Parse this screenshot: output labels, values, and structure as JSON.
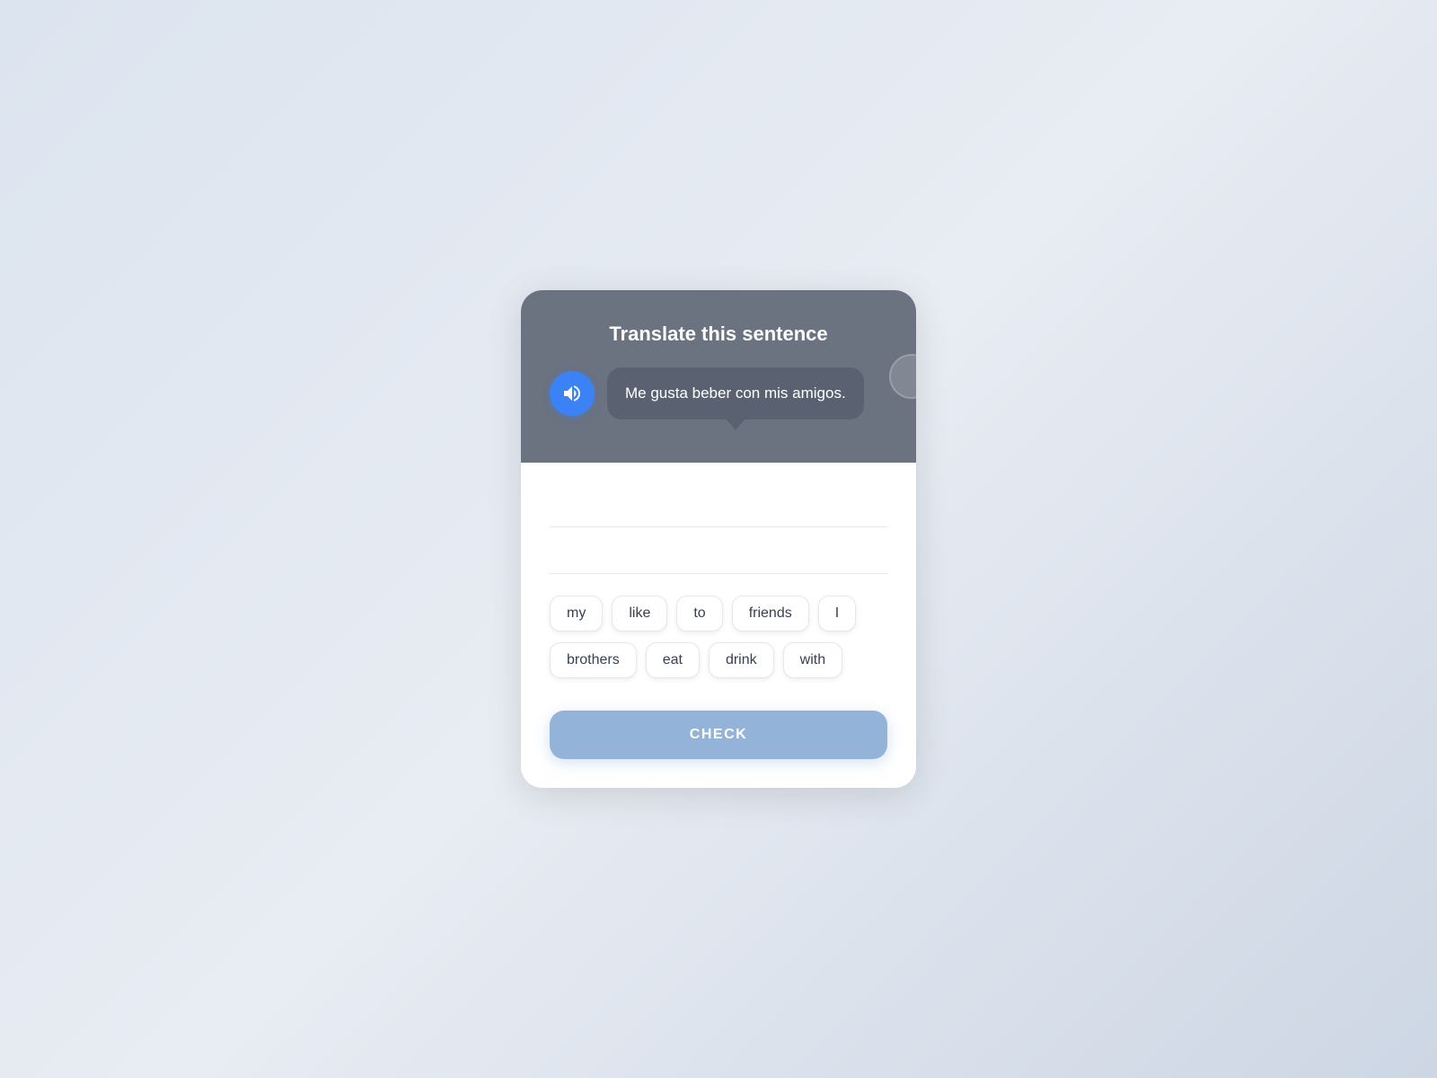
{
  "header": {
    "title": "Translate this sentence",
    "sentence": "Me gusta beber con mis amigos.",
    "speaker_label": "Play audio"
  },
  "decoration": {
    "circle": true
  },
  "answer_slots": [
    {
      "id": 1,
      "value": ""
    },
    {
      "id": 2,
      "value": ""
    }
  ],
  "word_options": {
    "row1": [
      {
        "id": "w1",
        "label": "my"
      },
      {
        "id": "w2",
        "label": "like"
      },
      {
        "id": "w3",
        "label": "to"
      },
      {
        "id": "w4",
        "label": "friends"
      },
      {
        "id": "w5",
        "label": "I"
      }
    ],
    "row2": [
      {
        "id": "w6",
        "label": "brothers"
      },
      {
        "id": "w7",
        "label": "eat"
      },
      {
        "id": "w8",
        "label": "drink"
      },
      {
        "id": "w9",
        "label": "with"
      }
    ]
  },
  "check_button": {
    "label": "CHECK"
  }
}
